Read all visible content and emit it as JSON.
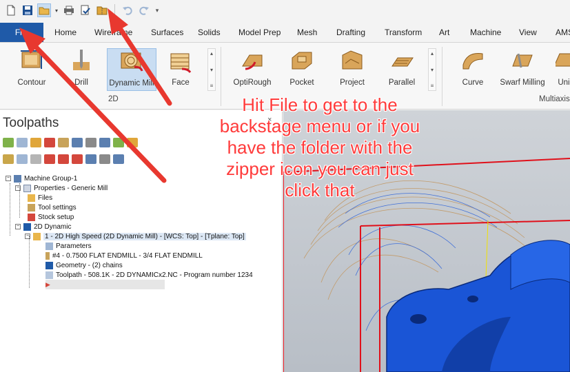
{
  "quick_access": {
    "items": [
      "new-icon",
      "save-icon",
      "open-icon",
      "print-icon",
      "print-preview-icon",
      "zip2go-icon",
      "undo-icon",
      "redo-icon",
      "customize-icon"
    ]
  },
  "tabs": [
    "File",
    "Home",
    "Wireframe",
    "Surfaces",
    "Solids",
    "Model Prep",
    "Mesh",
    "Drafting",
    "Transform",
    "Art",
    "Machine",
    "View",
    "AMS"
  ],
  "ribbon": {
    "group_2d": {
      "label": "2D",
      "buttons": [
        "Contour",
        "Drill",
        "Dynamic Mill",
        "Face"
      ]
    },
    "group_3d": {
      "buttons": [
        "OptiRough",
        "Pocket",
        "Project",
        "Parallel"
      ]
    },
    "group_multiaxis": {
      "label": "Multiaxis",
      "buttons": [
        "Curve",
        "Swarf Milling",
        "Uni"
      ]
    }
  },
  "toolpaths": {
    "title": "Toolpaths",
    "close_glyph": "×",
    "tree": [
      {
        "label": "Machine Group-1"
      },
      {
        "label": "Properties - Generic Mill"
      },
      {
        "label": "Files"
      },
      {
        "label": "Tool settings"
      },
      {
        "label": "Stock setup"
      },
      {
        "label": "2D Dynamic"
      },
      {
        "label": "1 - 2D High Speed (2D Dynamic Mill) - [WCS: Top] - [Tplane: Top]"
      },
      {
        "label": "Parameters"
      },
      {
        "label": "#4 - 0.7500 FLAT ENDMILL - 3/4 FLAT ENDMILL"
      },
      {
        "label": "Geometry - (2) chains"
      },
      {
        "label": "Toolpath - 508.1K - 2D DYNAMICx2.NC - Program number 1234"
      }
    ]
  },
  "annotation": {
    "text_lines": [
      "Hit File to get to the",
      "backstage menu or if you",
      "have the folder with the",
      "zipper icon you can just",
      "click that"
    ]
  },
  "colors": {
    "file_tab": "#1f5aa8",
    "arrow": "#e8382f",
    "callout_text": "#ff3b3b",
    "part_blue": "#1a55d6",
    "stock_red": "#e0101a"
  }
}
